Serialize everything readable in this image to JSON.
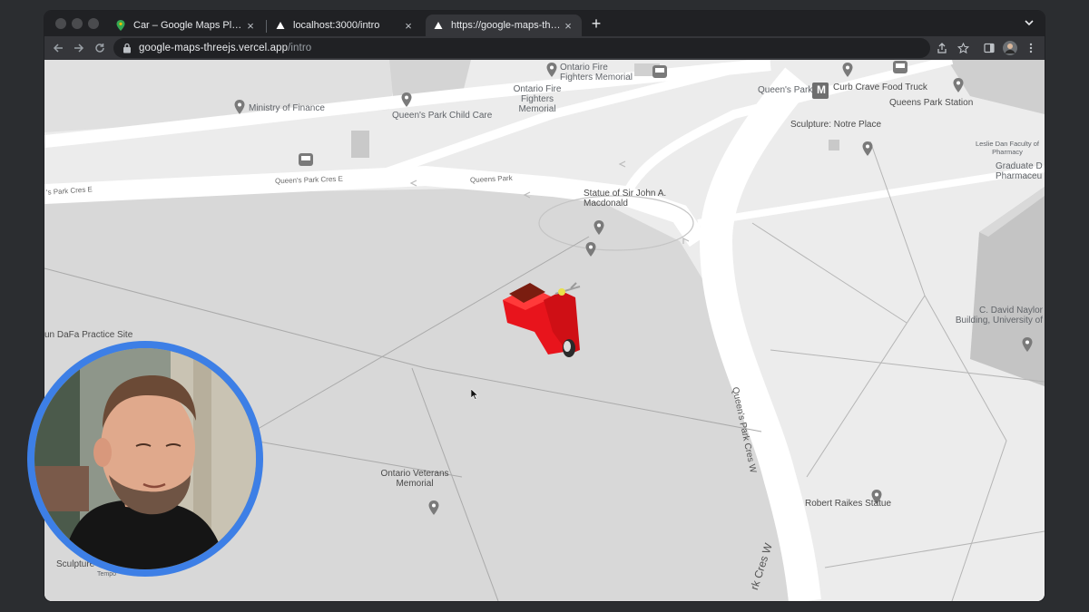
{
  "browser": {
    "tabs": [
      {
        "title": "Car – Google Maps Platform –",
        "favicon": "google-maps-pin-icon",
        "active": false
      },
      {
        "title": "localhost:3000/intro",
        "favicon": "vercel-triangle-icon",
        "active": false
      },
      {
        "title": "https://google-maps-threejs.vercel.app/intro",
        "favicon": "vercel-triangle-icon",
        "active": true
      }
    ],
    "url_host": "google-maps-threejs.vercel.app",
    "url_path": "/intro"
  },
  "map": {
    "poi_labels": [
      {
        "key": "ontario_fire_fighters_memorial",
        "text": "Ontario Fire Fighters Memorial"
      },
      {
        "key": "ontario_fire_fighters_memorial_b",
        "text": "Ontario Fire Fighters Memorial"
      },
      {
        "key": "ministry_of_finance",
        "text": "Ministry of Finance"
      },
      {
        "key": "queens_park_child_care",
        "text": "Queen's Park Child Care"
      },
      {
        "key": "queens_park",
        "text": "Queen's Park"
      },
      {
        "key": "curb_crave",
        "text": "Curb Crave Food Truck"
      },
      {
        "key": "queens_park_station",
        "text": "Queens Park Station"
      },
      {
        "key": "sculpture_notre_place",
        "text": "Sculpture: Notre Place"
      },
      {
        "key": "leslie_dan",
        "text": "Leslie Dan Faculty of Pharmacy"
      },
      {
        "key": "graduate_pharmaceu",
        "text": "Graduate D Pharmaceu"
      },
      {
        "key": "statue_macdonald",
        "text": "Statue of Sir John A. Macdonald"
      },
      {
        "key": "falun_dafa",
        "text": "un DaFa Practice Site"
      },
      {
        "key": "c_david_naylor",
        "text": "C. David Naylor Building, University of"
      },
      {
        "key": "ontario_veterans",
        "text": "Ontario Veterans Memorial"
      },
      {
        "key": "robert_raikes",
        "text": "Robert Raikes Statue"
      },
      {
        "key": "sculpture_bottom",
        "text": "Sculpture"
      },
      {
        "key": "tempo",
        "text": "Tempo"
      }
    ],
    "road_labels": {
      "queens_park_cres_e_left": "'s Park Cres E",
      "queens_park_cres_e": "Queen's Park Cres E",
      "queens_park": "Queens Park",
      "queens_park_cres_w": "Queen's Park Cres W",
      "park_cres_w": "rk Cres W"
    },
    "metro_letter": "M"
  },
  "colors": {
    "browser_chrome": "#35363a",
    "tabstrip": "#202124",
    "map_ground": "#ececec",
    "map_plaza": "#dcdcdc",
    "map_road": "#ffffff",
    "scooter_red": "#e8141c",
    "webcam_ring": "#3d7fe6"
  }
}
